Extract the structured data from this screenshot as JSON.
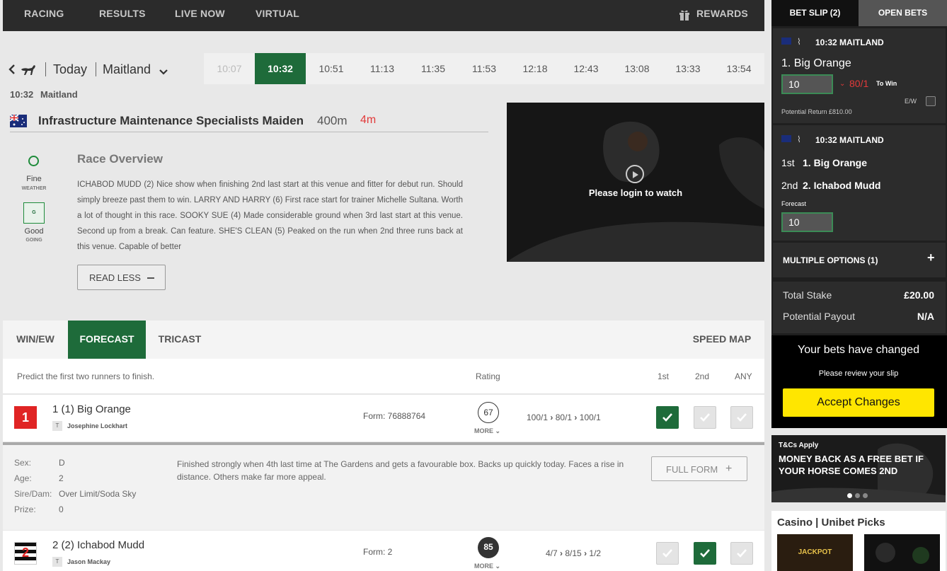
{
  "nav": {
    "racing": "RACING",
    "results": "RESULTS",
    "live_now": "LIVE NOW",
    "virtual": "VIRTUAL",
    "rewards": "REWARDS"
  },
  "race_header": {
    "day": "Today",
    "venue": "Maitland",
    "subtitle_time": "10:32",
    "subtitle_venue": "Maitland"
  },
  "times": [
    {
      "label": "10:07",
      "state": "past"
    },
    {
      "label": "10:32",
      "state": "active"
    },
    {
      "label": "10:51",
      "state": "normal"
    },
    {
      "label": "11:13",
      "state": "normal"
    },
    {
      "label": "11:35",
      "state": "normal"
    },
    {
      "label": "11:53",
      "state": "normal"
    },
    {
      "label": "12:18",
      "state": "normal"
    },
    {
      "label": "12:43",
      "state": "normal"
    },
    {
      "label": "13:08",
      "state": "normal"
    },
    {
      "label": "13:33",
      "state": "normal"
    },
    {
      "label": "13:54",
      "state": "normal"
    }
  ],
  "race": {
    "name": "Infrastructure Maintenance Specialists Maiden",
    "distance": "400m",
    "countdown": "4m"
  },
  "conditions": {
    "weather_value": "Fine",
    "weather_label": "WEATHER",
    "going_badge": "G",
    "going_value": "Good",
    "going_label": "GOING"
  },
  "overview": {
    "title": "Race Overview",
    "text": "ICHABOD MUDD (2) Nice show when finishing 2nd last start at this venue and fitter for debut run. Should simply breeze past them to win. LARRY AND HARRY (6) First race start for trainer Michelle Sultana. Worth a lot of thought in this race. SOOKY SUE (4) Made considerable ground when 3rd last start at this venue. Second up from a break. Can feature. SHE'S CLEAN (5) Peaked on the run when 2nd three runs back at this venue. Capable of better",
    "read_less": "READ LESS"
  },
  "video": {
    "message": "Please login to watch"
  },
  "tabs": {
    "win_ew": "WIN/EW",
    "forecast": "FORECAST",
    "tricast": "TRICAST",
    "speed_map": "SPEED MAP"
  },
  "table": {
    "instruction": "Predict the first two runners to finish.",
    "rating_header": "Rating",
    "col_1st": "1st",
    "col_2nd": "2nd",
    "col_any": "ANY"
  },
  "runners": [
    {
      "number": "1",
      "name": "1 (1) Big Orange",
      "trainer_badge": "T",
      "trainer": "Josephine Lockhart",
      "form": "Form: 76888764",
      "rating": "67",
      "more": "MORE",
      "odds1": "100/1",
      "odds2": "80/1",
      "odds3": "100/1"
    },
    {
      "number": "2",
      "name": "2 (2) Ichabod Mudd",
      "trainer_badge": "T",
      "trainer": "Jason Mackay",
      "form": "Form: 2",
      "rating": "85",
      "more": "MORE",
      "odds1": "4/7",
      "odds2": "8/15",
      "odds3": "1/2"
    }
  ],
  "details": {
    "sex_label": "Sex:",
    "sex": "D",
    "age_label": "Age:",
    "age": "2",
    "sire_label": "Sire/Dam:",
    "sire": "Over Limit/Soda Sky",
    "prize_label": "Prize:",
    "prize": "0",
    "comment": "Finished strongly when 4th last time at The Gardens and gets a favourable box. Backs up quickly today. Faces a rise in distance. Others make far more appeal.",
    "full_form": "FULL FORM"
  },
  "betslip": {
    "tab_slip": "BET SLIP (2)",
    "tab_open": "OPEN BETS",
    "bet1": {
      "race": "10:32 MAITLAND",
      "selection": "1. Big Orange",
      "stake": "10",
      "odds": "80/1",
      "to_win": "To Win",
      "ew": "E/W",
      "potential_return": "Potential Return  £810.00"
    },
    "bet2": {
      "race": "10:32 MAITLAND",
      "first_label": "1st",
      "first": "1. Big Orange",
      "second_label": "2nd",
      "second": "2. Ichabod Mudd",
      "type": "Forecast",
      "stake": "10"
    },
    "multiple": "MULTIPLE OPTIONS (1)",
    "total_stake_label": "Total Stake",
    "total_stake": "£20.00",
    "payout_label": "Potential Payout",
    "payout": "N/A",
    "changed_title": "Your bets have changed",
    "changed_sub": "Please review your slip",
    "accept": "Accept Changes"
  },
  "promo": {
    "tc": "T&Cs Apply",
    "text": "MONEY BACK AS A FREE BET IF YOUR HORSE COMES 2ND"
  },
  "casino": {
    "title": "Casino | Unibet Picks",
    "game1": "JACKPOT"
  },
  "colors": {
    "brand_green": "#1e6b3a",
    "accept_yellow": "#ffe600",
    "alert_red": "#e23a3a"
  }
}
